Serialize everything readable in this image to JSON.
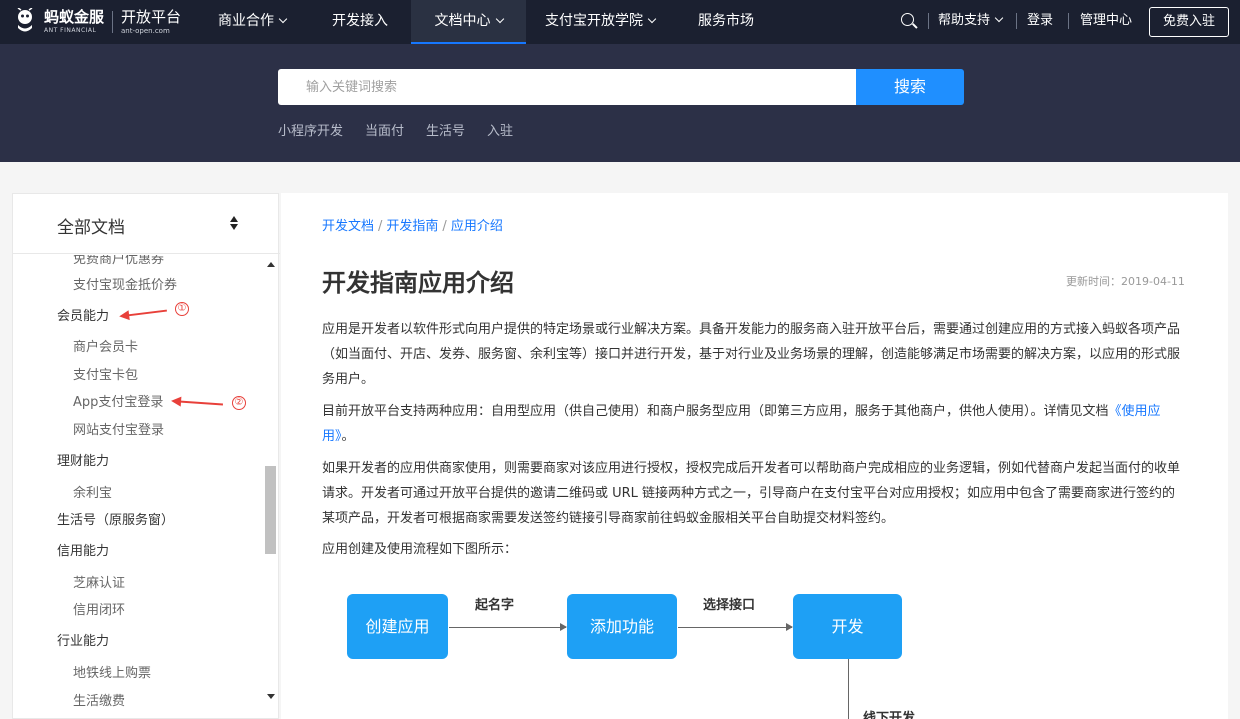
{
  "nav": {
    "logo_cn": "蚂蚁金服",
    "logo_en": "ANT FINANCIAL",
    "platform_cn": "开放平台",
    "platform_en": "ant-open.com",
    "items": [
      {
        "label": "商业合作"
      },
      {
        "label": "开发接入"
      },
      {
        "label": "文档中心"
      },
      {
        "label": "支付宝开放学院"
      },
      {
        "label": "服务市场"
      }
    ],
    "help": "帮助支持",
    "login": "登录",
    "admin": "管理中心",
    "free_join": "免费入驻"
  },
  "hero": {
    "search_placeholder": "输入关键词搜索",
    "search_button": "搜索",
    "hot_links": [
      "小程序开发",
      "当面付",
      "生活号",
      "入驻"
    ]
  },
  "sidebar": {
    "title": "全部文档",
    "items": [
      {
        "label": "免费商户优惠券"
      },
      {
        "label": "支付宝现金抵价券"
      },
      {
        "label": "会员能力"
      },
      {
        "label": "商户会员卡"
      },
      {
        "label": "支付宝卡包"
      },
      {
        "label": "App支付宝登录"
      },
      {
        "label": "网站支付宝登录"
      },
      {
        "label": "理财能力"
      },
      {
        "label": "余利宝"
      },
      {
        "label": "生活号（原服务窗）"
      },
      {
        "label": "信用能力"
      },
      {
        "label": "芝麻认证"
      },
      {
        "label": "信用闭环"
      },
      {
        "label": "行业能力"
      },
      {
        "label": "地铁线上购票"
      },
      {
        "label": "生活缴费"
      }
    ],
    "annotations": [
      "①",
      "②"
    ]
  },
  "content": {
    "breadcrumb": [
      "开发文档",
      "开发指南",
      "应用介绍"
    ],
    "title": "开发指南应用介绍",
    "updated": "更新时间：2019-04-11",
    "p1": "应用是开发者以软件形式向用户提供的特定场景或行业解决方案。具备开发能力的服务商入驻开放平台后，需要通过创建应用的方式接入蚂蚁各项产品（如当面付、开店、发券、服务窗、余利宝等）接口并进行开发，基于对行业及业务场景的理解，创造能够满足市场需要的解决方案，以应用的形式服务用户。",
    "p2_text": "目前开放平台支持两种应用：自用型应用（供自己使用）和商户服务型应用（即第三方应用，服务于其他商户，供他人使用）。详情见文档",
    "p2_link": "《使用应用》",
    "p2_end": "。",
    "p3": "如果开发者的应用供商家使用，则需要商家对该应用进行授权，授权完成后开发者可以帮助商户完成相应的业务逻辑，例如代替商户发起当面付的收单请求。开发者可通过开放平台提供的邀请二维码或 URL 链接两种方式之一，引导商户在支付宝平台对应用授权；如应用中包含了需要商家进行签约的某项产品，开发者可根据商家需要发送签约链接引导商家前往蚂蚁金服相关平台自助提交材料签约。",
    "p4": "应用创建及使用流程如下图所示：",
    "flow": {
      "boxes": [
        "创建应用",
        "添加功能",
        "开发"
      ],
      "labels": [
        "起名字",
        "选择接口",
        "线下开发"
      ]
    }
  }
}
